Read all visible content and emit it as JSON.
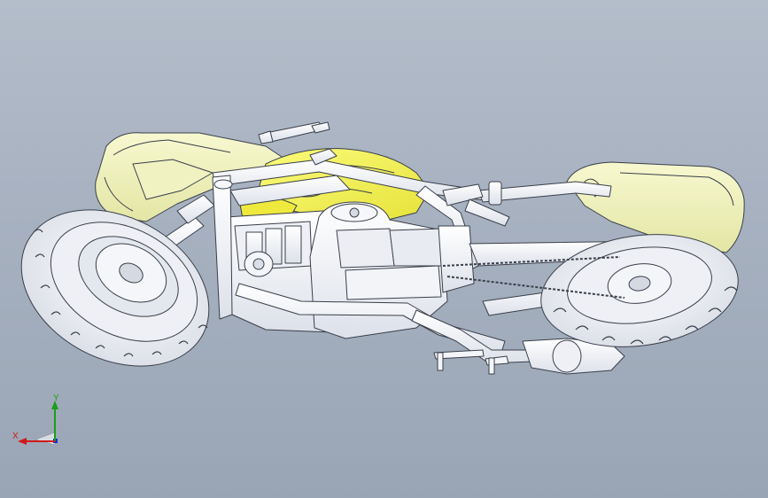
{
  "viewport": {
    "background_top": "#b4bdca",
    "background_bottom": "#99a5b5",
    "model_name": "motorcycle-assembly",
    "outline_color": "#3a3f4a",
    "tank_color": "#f2f24a",
    "body_color": "#eef0b8",
    "metal_color": "#f4f6fa",
    "tire_color": "#f7f8fb"
  },
  "triad": {
    "x_label": "X",
    "y_label": "Y",
    "x_color": "#d01818",
    "y_color": "#18a018",
    "z_color": "#1830d0"
  }
}
